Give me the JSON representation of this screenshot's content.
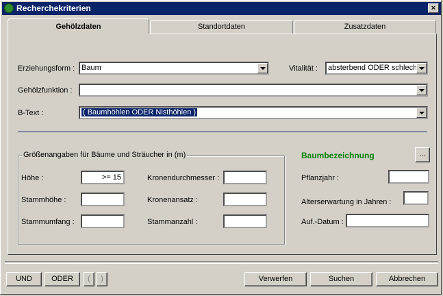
{
  "window": {
    "title": "Recherchekriterien",
    "close": "×"
  },
  "tabs": [
    {
      "label": "Gehölzdaten",
      "active": true
    },
    {
      "label": "Standortdaten",
      "active": false
    },
    {
      "label": "Zusatzdaten",
      "active": false
    }
  ],
  "form": {
    "erziehungsform_label": "Erziehungsform :",
    "erziehungsform_value": "Baum",
    "vitalitaet_label": "Vitalität :",
    "vitalitaet_value": "absterbend ODER schlecht",
    "gehoelzfunktion_label": "Gehölzfunktion :",
    "gehoelzfunktion_value": "",
    "btext_label": "B-Text :",
    "btext_value": "( Baumhöhlen ODER Nisthöhlen )"
  },
  "groesse": {
    "title": "Größenangaben für Bäume und Sträucher in (m)",
    "hoehe_label": "Höhe :",
    "hoehe_value": ">= 15",
    "stammhoehe_label": "Stammhöhe :",
    "stammhoehe_value": "",
    "stammumfang_label": "Stammumfang :",
    "stammumfang_value": "",
    "kronendurchmesser_label": "Kronendurchmesser :",
    "kronendurchmesser_value": "",
    "kronenansatz_label": "Kronenansatz :",
    "kronenansatz_value": "",
    "stammanzahl_label": "Stammanzahl :",
    "stammanzahl_value": ""
  },
  "baum": {
    "title": "Baumbezeichnung",
    "ellipsis": "...",
    "pflanzjahr_label": "Pflanzjahr :",
    "pflanzjahr_value": "",
    "alterserwartung_label": "Alterserwartung in Jahren :",
    "alterserwartung_value": "",
    "aufdatum_label": "Auf.-Datum :",
    "aufdatum_value": ""
  },
  "buttons": {
    "und": "UND",
    "oder": "ODER",
    "paren_open": "(",
    "paren_close": ")",
    "verwerfen": "Verwerfen",
    "suchen": "Suchen",
    "abbrechen": "Abbrechen"
  },
  "colors": {
    "titlebar": "#0a246a",
    "heading_green": "#008000",
    "face": "#d4d0c8"
  }
}
